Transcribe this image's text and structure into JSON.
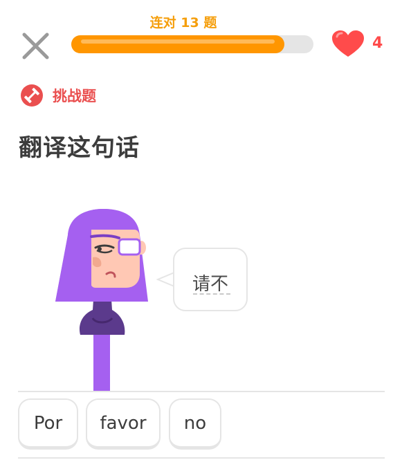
{
  "header": {
    "streak_label": "连对 13 题",
    "progress": 0.88,
    "hearts": "4",
    "close_icon": "close-icon",
    "heart_icon": "heart-icon"
  },
  "challenge": {
    "label": "挑战题",
    "icon": "dumbbell-icon"
  },
  "prompt": {
    "title": "翻译这句话",
    "sentence": "请不"
  },
  "word_bank": [
    "Por",
    "favor",
    "no"
  ],
  "colors": {
    "accent": "#ff9600",
    "streak": "#f59e0b",
    "heart": "#ff4b4b",
    "challenge": "#ea4f4f",
    "character_hair": "#a560f0",
    "character_body": "#5b3a8c"
  }
}
